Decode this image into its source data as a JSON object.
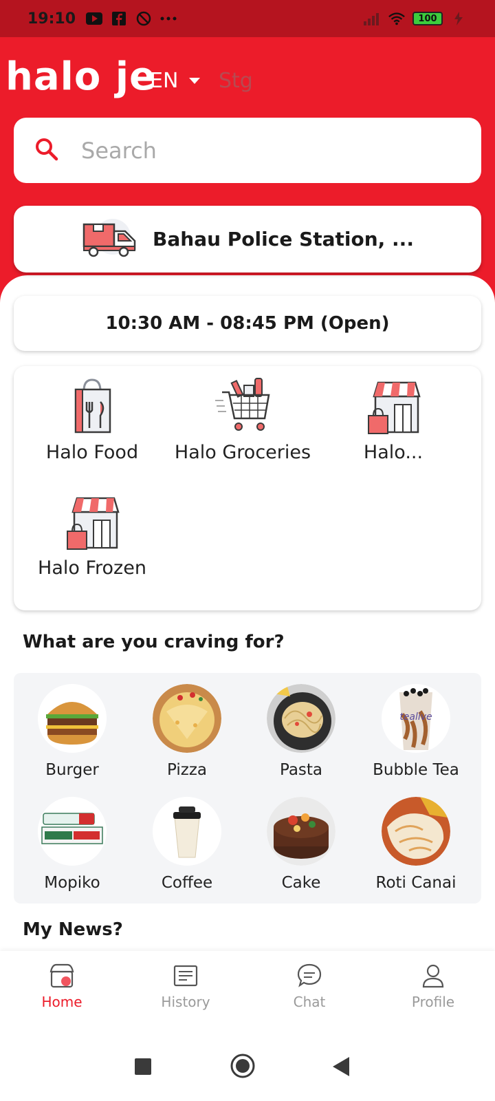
{
  "status_bar": {
    "time": "19:10",
    "left_icons": [
      "youtube-icon",
      "facebook-icon",
      "no-disturb-icon",
      "more-dots-icon"
    ],
    "battery": "100",
    "right_icons": [
      "signal-icon",
      "wifi-icon",
      "battery-icon",
      "charging-icon"
    ]
  },
  "header": {
    "logo": "halo je",
    "language": "EN",
    "env": "Stg"
  },
  "search": {
    "placeholder": "Search"
  },
  "delivery": {
    "address": "Bahau Police Station, ..."
  },
  "hours": {
    "text": "10:30 AM - 08:45 PM  (Open)"
  },
  "services": [
    {
      "label": "Halo Food",
      "icon": "food-bag-icon"
    },
    {
      "label": "Halo Groceries",
      "icon": "grocery-cart-icon"
    },
    {
      "label": "Halo...",
      "icon": "store-icon"
    },
    {
      "label": "Halo Frozen",
      "icon": "store-icon"
    }
  ],
  "craving": {
    "title": "What are you craving for?",
    "items": [
      {
        "label": "Burger"
      },
      {
        "label": "Pizza"
      },
      {
        "label": "Pasta"
      },
      {
        "label": "Bubble Tea"
      },
      {
        "label": "Mopiko"
      },
      {
        "label": "Coffee"
      },
      {
        "label": "Cake"
      },
      {
        "label": "Roti Canai"
      }
    ]
  },
  "news": {
    "title": "My News?"
  },
  "bottom_nav": {
    "items": [
      {
        "label": "Home",
        "icon": "home-store-icon",
        "active": true
      },
      {
        "label": "History",
        "icon": "history-icon",
        "active": false
      },
      {
        "label": "Chat",
        "icon": "chat-icon",
        "active": false
      },
      {
        "label": "Profile",
        "icon": "profile-icon",
        "active": false
      }
    ]
  },
  "colors": {
    "brand_red": "#ec1c2a",
    "status_bar": "#b5141f",
    "panel_gray": "#f4f5f7"
  }
}
